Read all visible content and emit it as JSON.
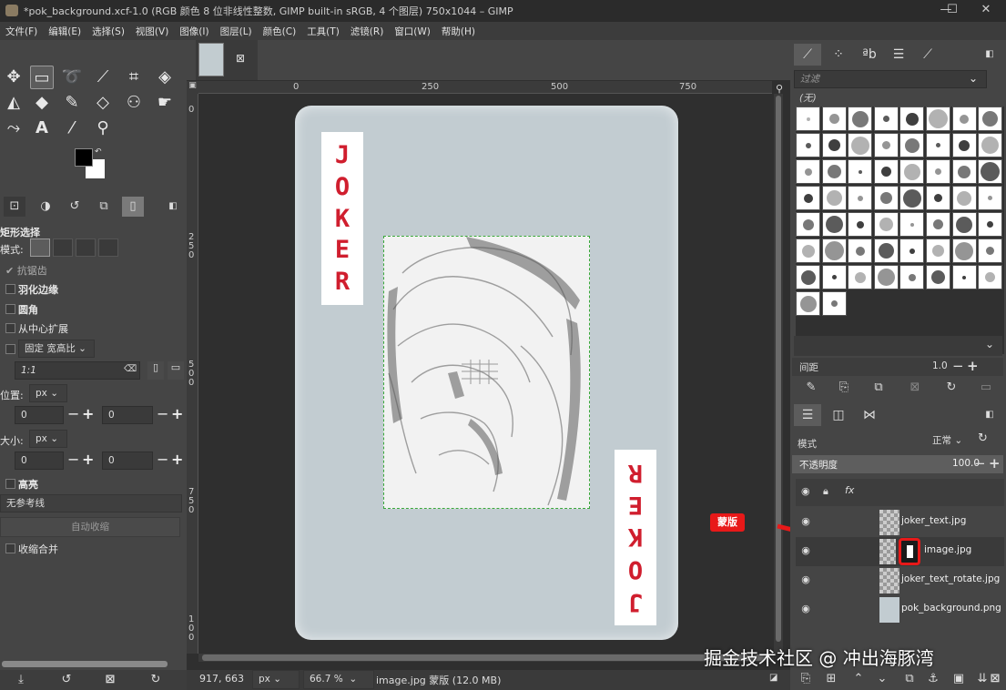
{
  "window": {
    "title": "*pok_background.xcf-1.0 (RGB 颜色 8 位非线性整数, GIMP built-in sRGB, 4 个图层) 750x1044 – GIMP",
    "minimize": "—",
    "maximize": "☐",
    "close": "✕"
  },
  "menubar": [
    "文件(F)",
    "编辑(E)",
    "选择(S)",
    "视图(V)",
    "图像(I)",
    "图层(L)",
    "颜色(C)",
    "工具(T)",
    "滤镜(R)",
    "窗口(W)",
    "帮助(H)"
  ],
  "tool_options": {
    "title": "矩形选择",
    "mode_label": "模式:",
    "antialias": "抗锯齿",
    "feather": "羽化边缘",
    "rounded": "圆角",
    "expand_center": "从中心扩展",
    "fixed_label": "固定",
    "fixed_value": "宽高比",
    "ratio": "1:1",
    "position_label": "位置:",
    "position_unit": "px",
    "pos_x": "0",
    "pos_y": "0",
    "size_label": "大小:",
    "size_unit": "px",
    "size_w": "0",
    "size_h": "0",
    "highlight": "高亮",
    "guides": "无参考线",
    "auto_shrink": "自动收缩",
    "shrink_merged": "收缩合并"
  },
  "ruler": {
    "h_ticks": [
      "0",
      "250",
      "500",
      "750"
    ],
    "v_ticks": [
      "0",
      "2",
      "5",
      "0",
      "5",
      "0",
      "0",
      "7",
      "5",
      "0",
      "1",
      "0",
      "0"
    ]
  },
  "card": {
    "text_top": [
      "J",
      "O",
      "K",
      "E",
      "R"
    ],
    "text_bottom": [
      "R",
      "E",
      "K",
      "O",
      "J"
    ]
  },
  "annotation": "蒙版",
  "status": {
    "coords": "917, 663",
    "unit": "px",
    "zoom": "66.7 %",
    "message": "image.jpg 蒙版 (12.0 MB)"
  },
  "brushes": {
    "filter_placeholder": "过滤",
    "tag_label": "(无)",
    "spacing_label": "间距",
    "spacing_value": "1.0"
  },
  "layers": {
    "mode_label": "模式",
    "mode_value": "正常",
    "opacity_label": "不透明度",
    "opacity_value": "100.0",
    "items": [
      {
        "name": "joker_text.jpg"
      },
      {
        "name": "image.jpg"
      },
      {
        "name": "joker_text_rotate.jpg"
      },
      {
        "name": "pok_background.png"
      }
    ]
  },
  "watermark": "掘金技术社区 @ 冲出海豚湾",
  "colors": {
    "card": "#c2ccd1",
    "joker_red": "#d01e2e",
    "accent_red": "#e81919",
    "selection_green": "#3aa83a"
  }
}
